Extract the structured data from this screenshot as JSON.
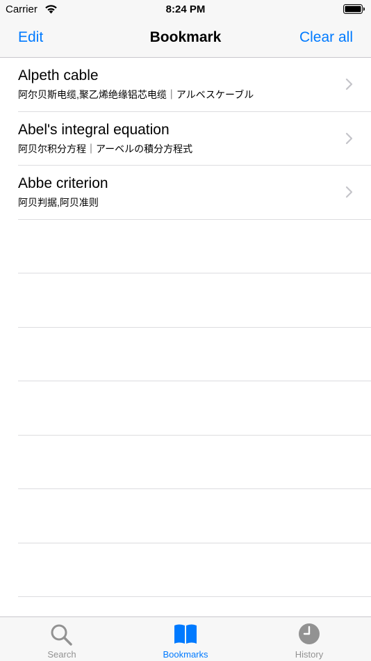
{
  "status_bar": {
    "carrier": "Carrier",
    "time": "8:24 PM"
  },
  "nav": {
    "left_button": "Edit",
    "title": "Bookmark",
    "right_button": "Clear all"
  },
  "bookmarks": [
    {
      "title": "Alpeth cable",
      "subtitle": "阿尔贝斯电缆,聚乙烯绝缘铝芯电缆｜アルベスケーブル"
    },
    {
      "title": "Abel's integral equation",
      "subtitle": "阿贝尔积分方程｜アーベルの積分方程式"
    },
    {
      "title": "Abbe criterion",
      "subtitle": "阿贝判据,阿贝准则"
    }
  ],
  "tabs": [
    {
      "label": "Search",
      "icon": "search-icon",
      "active": false
    },
    {
      "label": "Bookmarks",
      "icon": "book-icon",
      "active": true
    },
    {
      "label": "History",
      "icon": "clock-icon",
      "active": false
    }
  ],
  "colors": {
    "accent": "#007aff",
    "inactive_tab": "#929292",
    "bar_background": "#f7f7f7",
    "separator": "#dcdcdf"
  }
}
